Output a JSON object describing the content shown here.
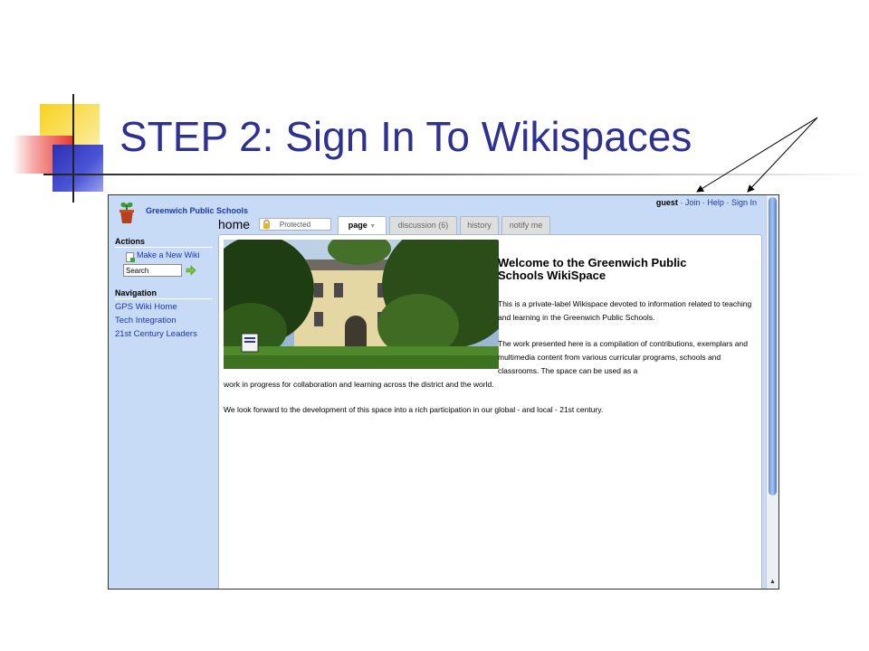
{
  "slide": {
    "title": "STEP 2: Sign In To Wikispaces"
  },
  "site": {
    "name": "Greenwich Public Schools",
    "user": "guest",
    "sep": "·",
    "links": [
      "Join",
      "Help",
      "Sign In"
    ]
  },
  "page": {
    "name": "home",
    "protected_label": "Protected",
    "tabs": [
      "page",
      "discussion (6)",
      "history",
      "notify me"
    ]
  },
  "sidebar": {
    "actions_heading": "Actions",
    "new_wiki_label": "Make a New Wiki",
    "search_value": "Search",
    "navigation_heading": "Navigation",
    "nav_items": [
      "GPS Wiki Home",
      "Tech Integration",
      "21st Century Leaders"
    ]
  },
  "content": {
    "heading": "Welcome to the Greenwich Public Schools WikiSpace",
    "para1": "This is a private-label Wikispace devoted to information related to teaching and learning in the Greenwich Public Schools.",
    "para2_top": "The work presented here is a compilation of contributions, exemplars and multimedia content from various curricular programs, schools and classrooms. The space can be used as a",
    "para2_bottom": "work in progress for collaboration and learning across the district and the world.",
    "para3": "We look forward to the development of this space into a rich participation in our global - and local - 21st century."
  },
  "colors": {
    "title": "#2e3192",
    "link": "#1a3aa8",
    "sidebar_bg": "#c7daf6"
  },
  "icons": [
    "flower-pot-logo-icon",
    "lock-icon",
    "dropdown-triangle-icon",
    "new-page-icon",
    "go-arrow-icon",
    "scroll-up-icon"
  ]
}
